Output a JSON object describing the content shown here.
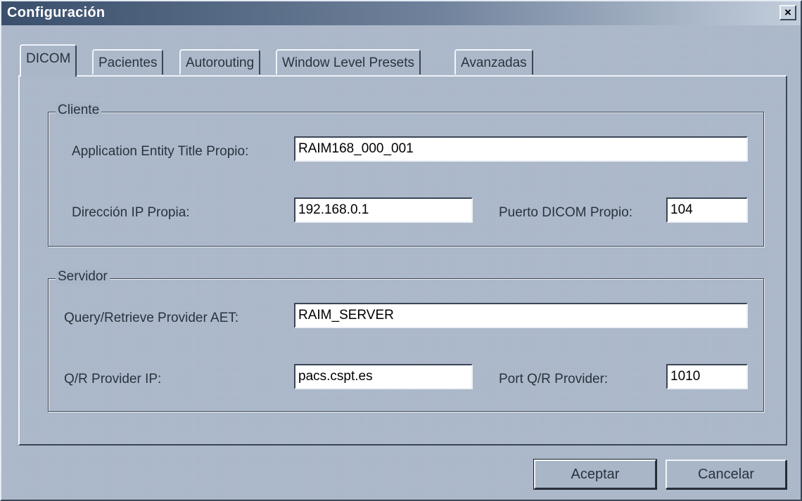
{
  "window": {
    "title": "Configuración",
    "close_glyph": "×"
  },
  "tabs": [
    {
      "label": "DICOM",
      "active": true
    },
    {
      "label": "Pacientes",
      "active": false
    },
    {
      "label": "Autorouting",
      "active": false
    },
    {
      "label": "Window Level Presets",
      "active": false
    },
    {
      "label": "Avanzadas",
      "active": false
    }
  ],
  "cliente": {
    "legend": "Cliente",
    "aet_label": "Application Entity Title Propio:",
    "aet_value": "RAIM168_000_001",
    "ip_label": "Dirección IP Propia:",
    "ip_value": "192.168.0.1",
    "port_label": "Puerto DICOM Propio:",
    "port_value": "104"
  },
  "servidor": {
    "legend": "Servidor",
    "aet_label": "Query/Retrieve Provider AET:",
    "aet_value": "RAIM_SERVER",
    "ip_label": "Q/R Provider IP:",
    "ip_value": "pacs.cspt.es",
    "port_label": "Port Q/R Provider:",
    "port_value": "1010"
  },
  "buttons": {
    "accept": "Aceptar",
    "cancel": "Cancelar"
  },
  "colors": {
    "window_bg": "#a9b6c8",
    "titlebar_dark": "#3a4f6c",
    "titlebar_light": "#c3cedc"
  }
}
